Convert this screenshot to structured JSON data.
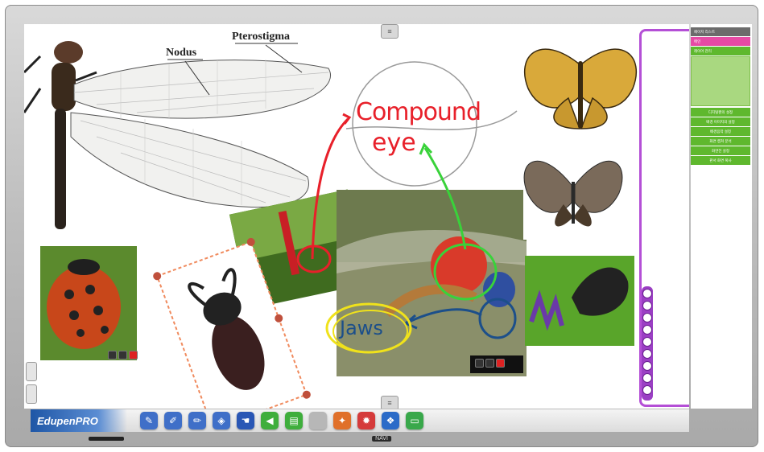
{
  "app": {
    "name": "EdupenPRO",
    "bezel_brand": "NAVI"
  },
  "annotations": {
    "label_nodus": "Nodus",
    "label_pterostigma": "Pterostigma",
    "label_compound_eye_line1": "Compound",
    "label_compound_eye_line2": "eye",
    "label_jaws": "Jaws"
  },
  "colors": {
    "accent_purple": "#b44fd6",
    "menu_green": "#5fb82e",
    "menu_pink": "#e64aa4",
    "ink_red": "#e8202a",
    "ink_green": "#39d23a",
    "ink_blue": "#1c4f8a",
    "ink_yellow": "#f0e21b",
    "selection_orange": "#f08a5d"
  },
  "toolbar": {
    "tools": [
      {
        "name": "pen",
        "icon": "pen-icon",
        "glyph": "✎",
        "color": "#3f6fc8"
      },
      {
        "name": "brush",
        "icon": "brush-icon",
        "glyph": "✐",
        "color": "#3f6fc8"
      },
      {
        "name": "highlighter",
        "icon": "highlighter-icon",
        "glyph": "✏",
        "color": "#3f6fc8"
      },
      {
        "name": "eraser",
        "icon": "eraser-icon",
        "glyph": "◈",
        "color": "#3f6fc8"
      },
      {
        "name": "select",
        "icon": "hand-select-icon",
        "glyph": "☚",
        "color": "#2a57b5"
      },
      {
        "name": "previous-page",
        "icon": "arrow-left-icon",
        "glyph": "◀",
        "color": "#3fae3c"
      },
      {
        "name": "new-page",
        "icon": "page-add-icon",
        "glyph": "▤",
        "color": "#3fae3c"
      },
      {
        "name": "blank",
        "icon": "blank-icon",
        "glyph": "",
        "color": "#b7b7b7"
      },
      {
        "name": "tools",
        "icon": "wrench-icon",
        "glyph": "✦",
        "color": "#e0702a"
      },
      {
        "name": "settings",
        "icon": "gear-icon",
        "glyph": "✹",
        "color": "#d53b3b"
      },
      {
        "name": "windows",
        "icon": "windows-icon",
        "glyph": "❖",
        "color": "#2b6bc8"
      },
      {
        "name": "screen",
        "icon": "monitor-icon",
        "glyph": "▭",
        "color": "#39a84b"
      }
    ]
  },
  "side_menu": {
    "header_items": [
      "페이지 리스트",
      "메인",
      "레이어 관리"
    ],
    "items": [
      "디지털펜의 설정",
      "배경 이미지의 설정",
      "배경음악 설정",
      "화면 캡쳐 분석",
      "화면전 설정",
      "판서 화면 복사"
    ]
  }
}
